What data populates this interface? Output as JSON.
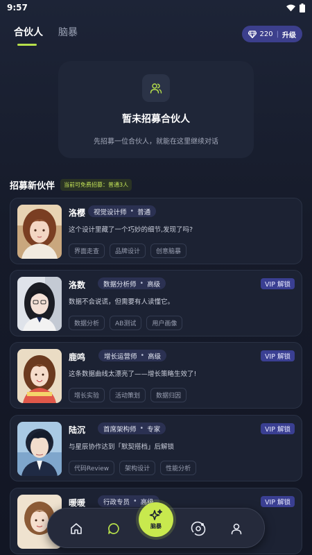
{
  "status": {
    "time": "9:57"
  },
  "tabs": [
    {
      "label": "合伙人"
    },
    {
      "label": "脑暴"
    }
  ],
  "credits": {
    "amount": "220",
    "separator": "|",
    "upgrade_label": "升级"
  },
  "empty_state": {
    "title": "暂未招募合伙人",
    "subtitle": "先招募一位合伙人，就能在这里继续对话",
    "icon": "users-icon"
  },
  "section": {
    "title": "招募新伙伴",
    "free_badge": "当前可免费招募：普通3人"
  },
  "partners": [
    {
      "name": "洛樱",
      "role": "视觉设计师",
      "level": "普通",
      "vip": "",
      "quote": "这个设计里藏了一个巧妙的细节,发现了吗?",
      "tags": [
        "界面走查",
        "品牌设计",
        "创意脑暴"
      ]
    },
    {
      "name": "洛数",
      "role": "数据分析师",
      "level": "高级",
      "vip": "VIP 解锁",
      "quote": "数据不会说谎，但需要有人读懂它。",
      "tags": [
        "数据分析",
        "AB测试",
        "用户画像"
      ]
    },
    {
      "name": "鹿鸣",
      "role": "增长运营师",
      "level": "高级",
      "vip": "VIP 解锁",
      "quote": "这条数据曲线太漂亮了——增长策略生效了!",
      "tags": [
        "增长实验",
        "活动策划",
        "数据归因"
      ]
    },
    {
      "name": "陆沉",
      "role": "首席架构师",
      "level": "专家",
      "vip": "VIP 解锁",
      "quote": "与星辰协作达到「默契搭档」后解锁",
      "tags": [
        "代码Review",
        "架构设计",
        "性能分析"
      ]
    },
    {
      "name": "暖暖",
      "role": "行政专员",
      "level": "高级",
      "vip": "VIP 解锁",
      "quote": "",
      "tags": []
    }
  ],
  "bottom_nav": {
    "items": [
      "home-icon",
      "chat-icon",
      "brainstorm-icon",
      "orbit-icon",
      "profile-icon"
    ],
    "fab_label": "脑暴"
  },
  "colors": {
    "accent": "#c8e94e",
    "vip": "#3a3f92",
    "card": "#1c2233"
  }
}
